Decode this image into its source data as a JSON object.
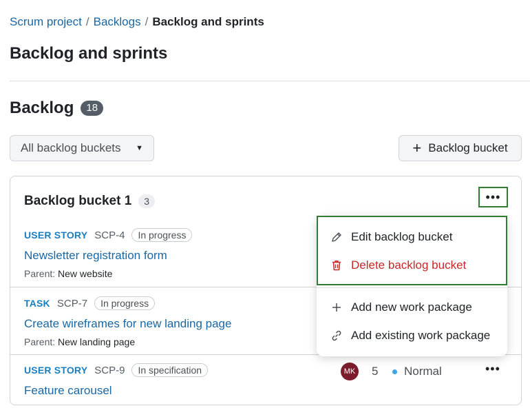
{
  "breadcrumb": {
    "items": [
      {
        "label": "Scrum project"
      },
      {
        "label": "Backlogs"
      }
    ],
    "separator": "/",
    "current": "Backlog and sprints"
  },
  "page": {
    "title": "Backlog and sprints"
  },
  "backlog": {
    "title": "Backlog",
    "count": "18",
    "filter_label": "All backlog buckets",
    "add_bucket_label": "Backlog bucket"
  },
  "bucket": {
    "title": "Backlog bucket 1",
    "count": "3"
  },
  "work_packages": [
    {
      "type": "USER STORY",
      "id": "SCP-4",
      "status": "In progress",
      "subject": "Newsletter registration form",
      "parent_label": "Parent:",
      "parent": "New website"
    },
    {
      "type": "TASK",
      "id": "SCP-7",
      "status": "In progress",
      "subject": "Create wireframes for new landing page",
      "parent_label": "Parent:",
      "parent": "New landing page"
    },
    {
      "type": "USER STORY",
      "id": "SCP-9",
      "status": "In specification",
      "subject": "Feature carousel",
      "assignee_initials": "MK",
      "story_points": "5",
      "priority": "Normal"
    }
  ],
  "menu": {
    "edit": "Edit backlog bucket",
    "delete": "Delete backlog bucket",
    "add_new": "Add new work package",
    "add_existing": "Add existing work package"
  },
  "colors": {
    "link": "#1a67a3",
    "type": "#1a7fc1",
    "danger": "#c62828",
    "highlight": "#2e7d32",
    "avatar": "#7b1d2d",
    "priority_dot": "#3ea5e6"
  }
}
